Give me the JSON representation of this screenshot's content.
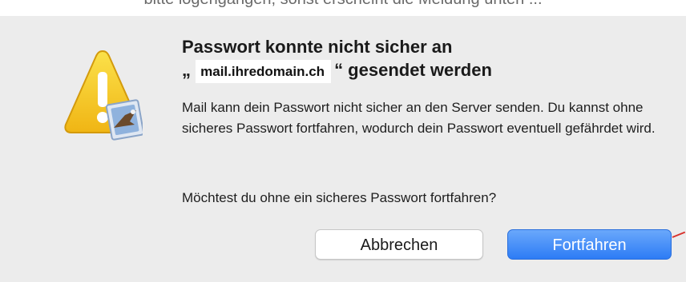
{
  "top_caption": "bitte logengangen, sonst erscheint die Meldung unten ...",
  "dialog": {
    "title_line1": "Passwort konnte nicht sicher an",
    "title_quote_open": "„",
    "title_domain": "mail.ihredomain.ch",
    "title_quote_close": "“",
    "title_line2_rest": " gesendet werden",
    "message": "Mail kann dein Passwort nicht sicher an den Server senden. Du kannst ohne sicheres Passwort fortfahren, wodurch dein Passwort eventuell gefährdet wird.",
    "question": "Möchtest du ohne ein sicheres Passwort fortfahren?",
    "cancel_label": "Abbrechen",
    "continue_label": "Fortfahren",
    "icon": "warning-triangle-icon",
    "badge_icon": "mail-stamp-eagle-icon"
  },
  "colors": {
    "dialog_bg": "#ececec",
    "accent": "#2d7cf5",
    "warning_yellow": "#f3c21b",
    "annotation_red": "#d8322c"
  }
}
